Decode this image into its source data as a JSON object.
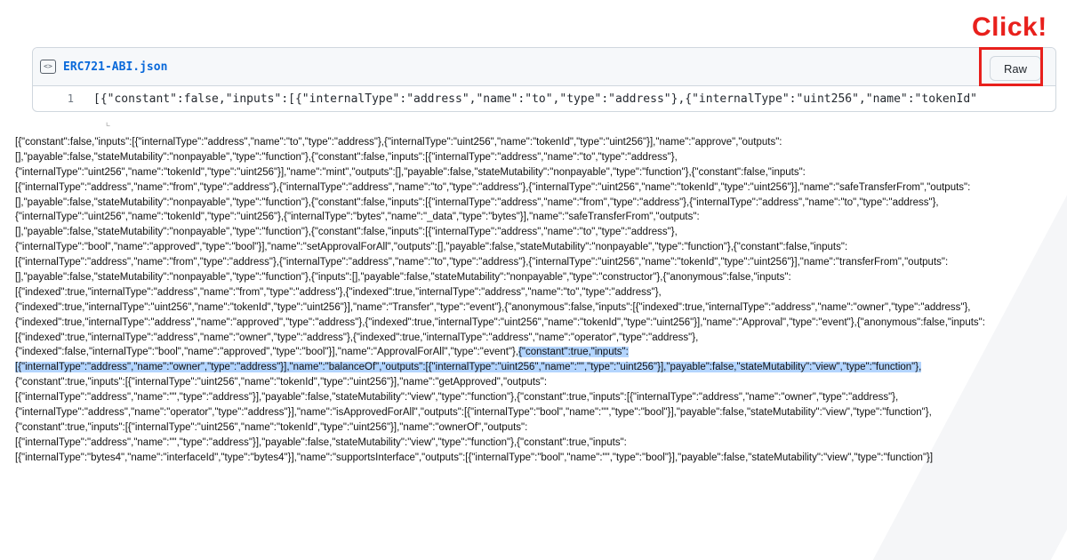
{
  "annotation": {
    "click_label": "Click!"
  },
  "file": {
    "name": "ERC721-ABI.json",
    "raw_button_label": "Raw",
    "line_number": "1",
    "line_preview": "[{\"constant\":false,\"inputs\":[{\"internalType\":\"address\",\"name\":\"to\",\"type\":\"address\"},{\"internalType\":\"uint256\",\"name\":\"tokenId\""
  },
  "cursor_glyph": "⌞",
  "raw_lines": [
    {
      "pre": "[{\"constant\":false,\"inputs\":[{\"internalType\":\"address\",\"name\":\"to\",\"type\":\"address\"},{\"internalType\":\"uint256\",\"name\":\"tokenId\",\"type\":\"uint256\"}],\"name\":\"approve\",\"outputs\":",
      "hl": ""
    },
    {
      "pre": "[],\"payable\":false,\"stateMutability\":\"nonpayable\",\"type\":\"function\"},{\"constant\":false,\"inputs\":[{\"internalType\":\"address\",\"name\":\"to\",\"type\":\"address\"},",
      "hl": ""
    },
    {
      "pre": "{\"internalType\":\"uint256\",\"name\":\"tokenId\",\"type\":\"uint256\"}],\"name\":\"mint\",\"outputs\":[],\"payable\":false,\"stateMutability\":\"nonpayable\",\"type\":\"function\"},{\"constant\":false,\"inputs\":",
      "hl": ""
    },
    {
      "pre": "[{\"internalType\":\"address\",\"name\":\"from\",\"type\":\"address\"},{\"internalType\":\"address\",\"name\":\"to\",\"type\":\"address\"},{\"internalType\":\"uint256\",\"name\":\"tokenId\",\"type\":\"uint256\"}],\"name\":\"safeTransferFrom\",\"outputs\":",
      "hl": ""
    },
    {
      "pre": "[],\"payable\":false,\"stateMutability\":\"nonpayable\",\"type\":\"function\"},{\"constant\":false,\"inputs\":[{\"internalType\":\"address\",\"name\":\"from\",\"type\":\"address\"},{\"internalType\":\"address\",\"name\":\"to\",\"type\":\"address\"},",
      "hl": ""
    },
    {
      "pre": "{\"internalType\":\"uint256\",\"name\":\"tokenId\",\"type\":\"uint256\"},{\"internalType\":\"bytes\",\"name\":\"_data\",\"type\":\"bytes\"}],\"name\":\"safeTransferFrom\",\"outputs\":",
      "hl": ""
    },
    {
      "pre": "[],\"payable\":false,\"stateMutability\":\"nonpayable\",\"type\":\"function\"},{\"constant\":false,\"inputs\":[{\"internalType\":\"address\",\"name\":\"to\",\"type\":\"address\"},",
      "hl": ""
    },
    {
      "pre": "{\"internalType\":\"bool\",\"name\":\"approved\",\"type\":\"bool\"}],\"name\":\"setApprovalForAll\",\"outputs\":[],\"payable\":false,\"stateMutability\":\"nonpayable\",\"type\":\"function\"},{\"constant\":false,\"inputs\":",
      "hl": ""
    },
    {
      "pre": "[{\"internalType\":\"address\",\"name\":\"from\",\"type\":\"address\"},{\"internalType\":\"address\",\"name\":\"to\",\"type\":\"address\"},{\"internalType\":\"uint256\",\"name\":\"tokenId\",\"type\":\"uint256\"}],\"name\":\"transferFrom\",\"outputs\":",
      "hl": ""
    },
    {
      "pre": "[],\"payable\":false,\"stateMutability\":\"nonpayable\",\"type\":\"function\"},{\"inputs\":[],\"payable\":false,\"stateMutability\":\"nonpayable\",\"type\":\"constructor\"},{\"anonymous\":false,\"inputs\":",
      "hl": ""
    },
    {
      "pre": "[{\"indexed\":true,\"internalType\":\"address\",\"name\":\"from\",\"type\":\"address\"},{\"indexed\":true,\"internalType\":\"address\",\"name\":\"to\",\"type\":\"address\"},",
      "hl": ""
    },
    {
      "pre": "{\"indexed\":true,\"internalType\":\"uint256\",\"name\":\"tokenId\",\"type\":\"uint256\"}],\"name\":\"Transfer\",\"type\":\"event\"},{\"anonymous\":false,\"inputs\":[{\"indexed\":true,\"internalType\":\"address\",\"name\":\"owner\",\"type\":\"address\"},",
      "hl": ""
    },
    {
      "pre": "{\"indexed\":true,\"internalType\":\"address\",\"name\":\"approved\",\"type\":\"address\"},{\"indexed\":true,\"internalType\":\"uint256\",\"name\":\"tokenId\",\"type\":\"uint256\"}],\"name\":\"Approval\",\"type\":\"event\"},{\"anonymous\":false,\"inputs\":",
      "hl": ""
    },
    {
      "pre": "[{\"indexed\":true,\"internalType\":\"address\",\"name\":\"owner\",\"type\":\"address\"},{\"indexed\":true,\"internalType\":\"address\",\"name\":\"operator\",\"type\":\"address\"},",
      "hl": ""
    },
    {
      "pre": "{\"indexed\":false,\"internalType\":\"bool\",\"name\":\"approved\",\"type\":\"bool\"}],\"name\":\"ApprovalForAll\",\"type\":\"event\"},",
      "hl": "{\"constant\":true,\"inputs\":"
    },
    {
      "pre": "",
      "hl": "[{\"internalType\":\"address\",\"name\":\"owner\",\"type\":\"address\"}],\"name\":\"balanceOf\",\"outputs\":[{\"internalType\":\"uint256\",\"name\":\"\",\"type\":\"uint256\"}],\"payable\":false,\"stateMutability\":\"view\",\"type\":\"function\"},"
    },
    {
      "pre": "{\"constant\":true,\"inputs\":[{\"internalType\":\"uint256\",\"name\":\"tokenId\",\"type\":\"uint256\"}],\"name\":\"getApproved\",\"outputs\":",
      "hl": ""
    },
    {
      "pre": "[{\"internalType\":\"address\",\"name\":\"\",\"type\":\"address\"}],\"payable\":false,\"stateMutability\":\"view\",\"type\":\"function\"},{\"constant\":true,\"inputs\":[{\"internalType\":\"address\",\"name\":\"owner\",\"type\":\"address\"},",
      "hl": ""
    },
    {
      "pre": "{\"internalType\":\"address\",\"name\":\"operator\",\"type\":\"address\"}],\"name\":\"isApprovedForAll\",\"outputs\":[{\"internalType\":\"bool\",\"name\":\"\",\"type\":\"bool\"}],\"payable\":false,\"stateMutability\":\"view\",\"type\":\"function\"},",
      "hl": ""
    },
    {
      "pre": "{\"constant\":true,\"inputs\":[{\"internalType\":\"uint256\",\"name\":\"tokenId\",\"type\":\"uint256\"}],\"name\":\"ownerOf\",\"outputs\":",
      "hl": ""
    },
    {
      "pre": "[{\"internalType\":\"address\",\"name\":\"\",\"type\":\"address\"}],\"payable\":false,\"stateMutability\":\"view\",\"type\":\"function\"},{\"constant\":true,\"inputs\":",
      "hl": ""
    },
    {
      "pre": "[{\"internalType\":\"bytes4\",\"name\":\"interfaceId\",\"type\":\"bytes4\"}],\"name\":\"supportsInterface\",\"outputs\":[{\"internalType\":\"bool\",\"name\":\"\",\"type\":\"bool\"}],\"payable\":false,\"stateMutability\":\"view\",\"type\":\"function\"}]",
      "hl": ""
    }
  ],
  "colors": {
    "accent_red": "#e8201c",
    "link_blue": "#0969da",
    "selection": "#b4d5fe"
  },
  "icons": {
    "file_type": "code-file-icon"
  }
}
